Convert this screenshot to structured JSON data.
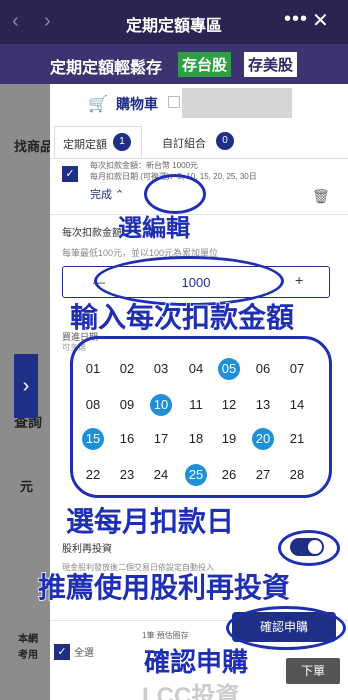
{
  "topbar": {
    "title": "定期定額專區",
    "back_icon": "‹",
    "forward_icon": "›",
    "more_icon": "•••",
    "close_icon": "✕"
  },
  "banner": {
    "title": "定期定額輕鬆存",
    "tag_tw": "存台股",
    "tag_us": "存美股"
  },
  "background": {
    "find": "找商品",
    "query": "查詢",
    "yuan": "元",
    "ben": "本網",
    "kao": "考用",
    "arrow": "›"
  },
  "cart": {
    "icon": "🛒",
    "title": "購物車"
  },
  "tabs": [
    {
      "label": "定期定額",
      "count": "1"
    },
    {
      "label": "自訂組合",
      "count": "0"
    }
  ],
  "item": {
    "check_icon": "✓",
    "amount_line": "每次扣款金額：新台幣 1000元",
    "dates_line": "每月扣款日期 (可複選)：5, 10, 15, 20, 25, 30日",
    "done_label": "完成 ⌃",
    "trash_icon": "🗑"
  },
  "amount": {
    "label": "每次扣款金額",
    "note": "每筆最低100元，並以100元為累加單位",
    "minus": "—",
    "value": "1000",
    "plus": "+"
  },
  "dates": {
    "label": "買進日期",
    "note": "可多選",
    "days": [
      "01",
      "02",
      "03",
      "04",
      "05",
      "06",
      "07",
      "08",
      "09",
      "10",
      "11",
      "12",
      "13",
      "14",
      "15",
      "16",
      "17",
      "18",
      "19",
      "20",
      "21",
      "22",
      "23",
      "24",
      "25",
      "26",
      "27",
      "28"
    ],
    "selected": [
      "05",
      "10",
      "15",
      "20",
      "25"
    ]
  },
  "reinvest": {
    "label": "股利再投資",
    "note": "現金股利發放後二個交易日依設定自動投入",
    "enabled": true
  },
  "bottom": {
    "check_icon": "✓",
    "select_all": "全選",
    "estimate": "1筆 預估圈存",
    "confirm": "確認申購",
    "order": "下單",
    "watermark": "LCC投資"
  },
  "annotations": {
    "edit": "選編輯",
    "amount": "輸入每次扣款金額",
    "days": "選每月扣款日",
    "reinvest": "推薦使用股利再投資",
    "confirm": "確認申購"
  }
}
